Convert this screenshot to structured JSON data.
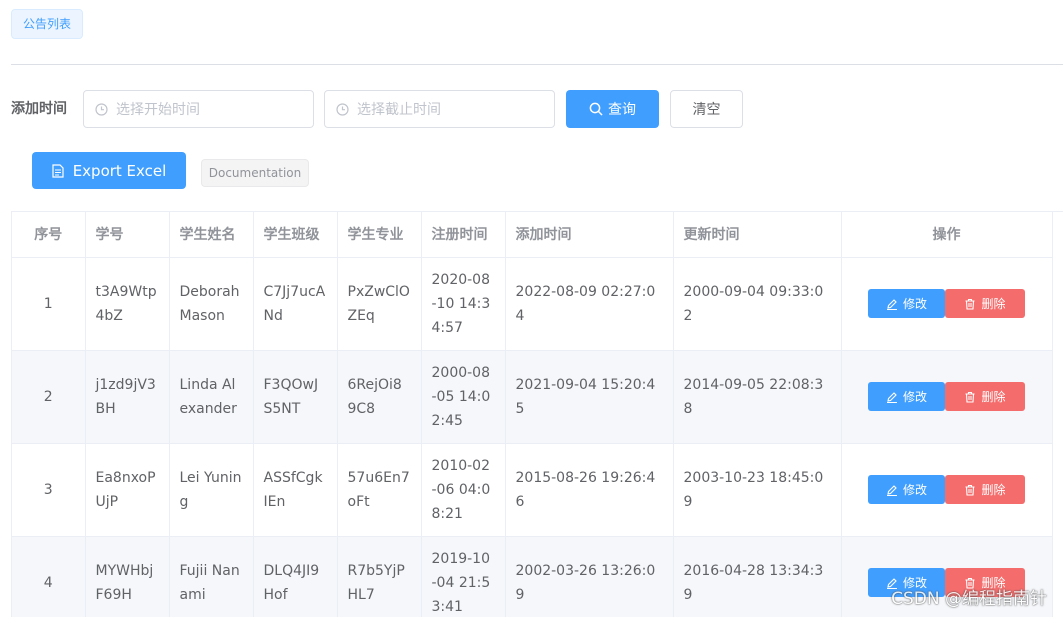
{
  "tag": {
    "label": "公告列表"
  },
  "filter": {
    "label": "添加时间",
    "start_placeholder": "选择开始时间",
    "end_placeholder": "选择截止时间",
    "search_label": "查询",
    "clear_label": "清空"
  },
  "actions": {
    "export_label": "Export Excel",
    "doc_label": "Documentation"
  },
  "table": {
    "headers": [
      "序号",
      "学号",
      "学生姓名",
      "学生班级",
      "学生专业",
      "注册时间",
      "添加时间",
      "更新时间",
      "操作"
    ],
    "edit_label": "修改",
    "delete_label": "删除",
    "rows": [
      {
        "index": "1",
        "id": "t3A9Wtp4bZ",
        "name": "Deborah Mason",
        "class": "C7Jj7ucANd",
        "major": "PxZwClOZEq",
        "registered": "2020-08-10 14:34:57",
        "added": "2022-08-09 02:27:04",
        "updated": "2000-09-04 09:33:02"
      },
      {
        "index": "2",
        "id": "j1zd9jV3BH",
        "name": "Linda Alexander",
        "class": "F3QOwJS5NT",
        "major": "6RejOi89C8",
        "registered": "2000-08-05 14:02:45",
        "added": "2021-09-04 15:20:45",
        "updated": "2014-09-05 22:08:38"
      },
      {
        "index": "3",
        "id": "Ea8nxoPUjP",
        "name": "Lei Yuning",
        "class": "ASSfCgkIEn",
        "major": "57u6En7oFt",
        "registered": "2010-02-06 04:08:21",
        "added": "2015-08-26 19:26:46",
        "updated": "2003-10-23 18:45:09"
      },
      {
        "index": "4",
        "id": "MYWHbjF69H",
        "name": "Fujii Nanami",
        "class": "DLQ4JI9Hof",
        "major": "R7b5YjPHL7",
        "registered": "2019-10-04 21:53:41",
        "added": "2002-03-26 13:26:09",
        "updated": "2016-04-28 13:34:39"
      }
    ]
  },
  "watermark": "CSDN @编程指南针",
  "colors": {
    "primary": "#409eff",
    "danger": "#f56c6c",
    "stripe": "#f5f7fa"
  }
}
